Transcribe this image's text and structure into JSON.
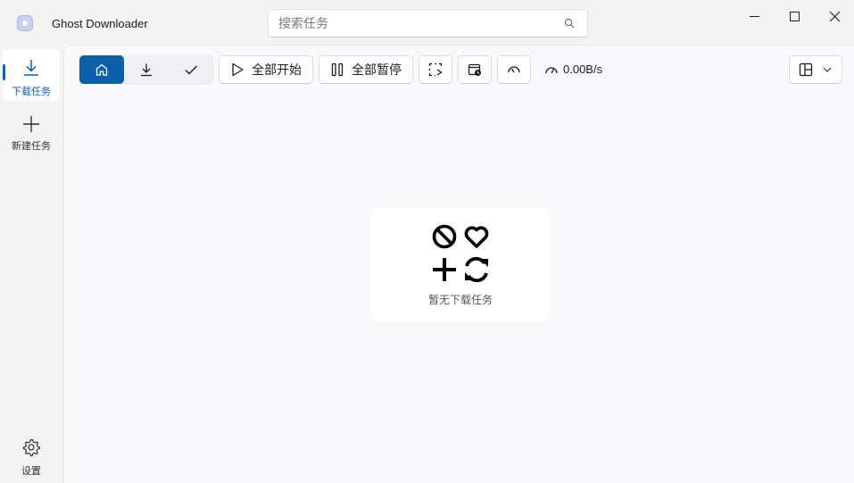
{
  "app": {
    "title": "Ghost Downloader"
  },
  "search": {
    "placeholder": "搜索任务"
  },
  "sidebar": {
    "items": [
      {
        "label": "下载任务",
        "icon": "download-icon",
        "active": true
      },
      {
        "label": "新建任务",
        "icon": "plus-icon",
        "active": false
      }
    ],
    "settings": {
      "label": "设置",
      "icon": "gear-icon"
    }
  },
  "toolbar": {
    "filter_tabs": [
      {
        "icon": "home-icon",
        "active": true
      },
      {
        "icon": "download-icon",
        "active": false
      },
      {
        "icon": "checkmark-icon",
        "active": false
      }
    ],
    "start_all_label": "全部开始",
    "pause_all_label": "全部暂停",
    "speed": "0.00B/s"
  },
  "empty_state": {
    "text": "暂无下载任务",
    "icons": [
      "block-icon",
      "heart-icon",
      "plus-icon",
      "refresh-icon"
    ]
  },
  "colors": {
    "accent": "#0c60a8",
    "background": "#f3f3f3",
    "panel": "#f8f9fc"
  }
}
